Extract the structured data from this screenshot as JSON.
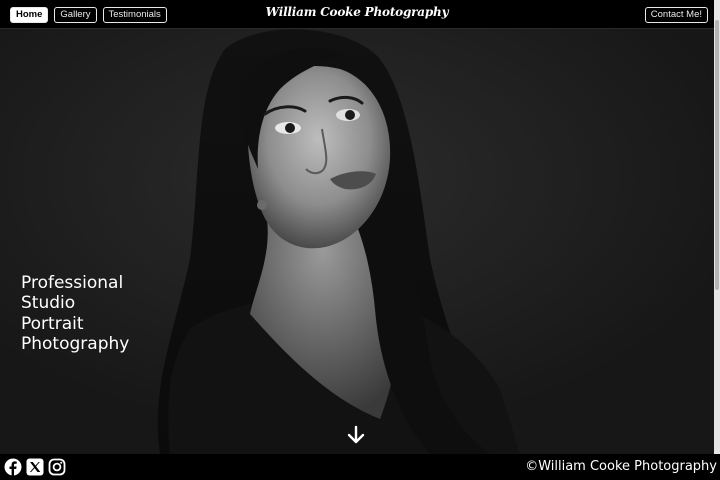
{
  "nav": {
    "items": [
      {
        "label": "Home",
        "active": true
      },
      {
        "label": "Gallery",
        "active": false
      },
      {
        "label": "Testimonials",
        "active": false
      }
    ],
    "brand": "William Cooke Photography",
    "contact_label": "Contact Me!"
  },
  "hero": {
    "tagline_lines": [
      "Professional",
      "Studio",
      "Portrait",
      "Photography"
    ],
    "scroll_icon": "arrow-down-icon"
  },
  "footer": {
    "social_icons": [
      "facebook-icon",
      "x-icon",
      "instagram-icon"
    ],
    "copyright": "©William Cooke Photography"
  },
  "colors": {
    "bar_background": "#000000",
    "hero_background": "#1f1f1f",
    "text": "#ffffff",
    "active_nav_background": "#ffffff"
  }
}
